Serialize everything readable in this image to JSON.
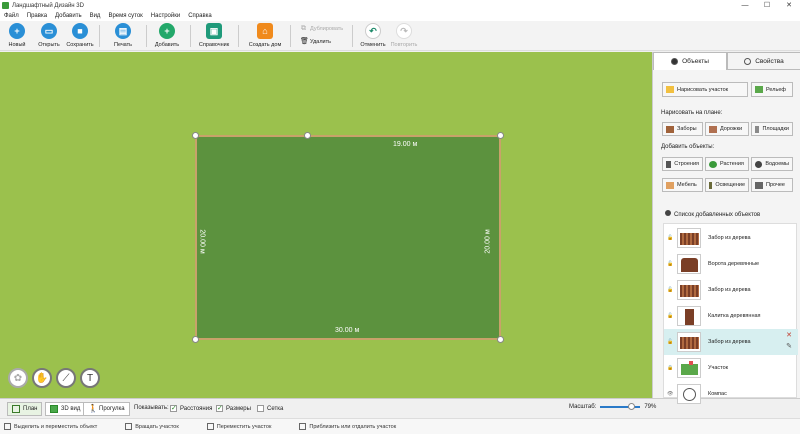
{
  "window": {
    "title": "Ландшафтный Дизайн 3D",
    "controls": [
      "—",
      "☐",
      "✕"
    ]
  },
  "menu": [
    "Файл",
    "Правка",
    "Добавить",
    "Вид",
    "Время суток",
    "Настройки",
    "Справка"
  ],
  "toolbar": {
    "new_label": "Новый",
    "open_label": "Открыть",
    "save_label": "Сохранить",
    "print_label": "Печать",
    "add_label": "Добавить",
    "reference_label": "Справочник",
    "create_house_label": "Создать дом",
    "duplicate_label": "Дублировать",
    "delete_label": "Удалить",
    "undo_label": "Отменить",
    "redo_label": "Повторить"
  },
  "canvas": {
    "dim_top": "19.00 м",
    "dim_bottom": "30.00 м",
    "dim_left": "20.00 м",
    "dim_right": "20.00 м"
  },
  "view_modes": {
    "plan": "План",
    "view3d": "3D вид",
    "walk": "Прогулка"
  },
  "show": {
    "label": "Показывать:",
    "distances": "Расстояния",
    "sizes": "Размеры",
    "grid": "Сетка",
    "distances_checked": true,
    "sizes_checked": true,
    "grid_checked": false
  },
  "scale": {
    "label": "Масштаб:",
    "value": "79%",
    "level_percent": 79
  },
  "status": {
    "select_move": "Выделить и переместить объект",
    "rotate": "Вращать участок",
    "move": "Переместить участок",
    "zoom": "Приблизить или отдалить участок"
  },
  "panel": {
    "tab_objects": "Объекты",
    "tab_properties": "Свойства",
    "draw_plot": "Нарисовать участок",
    "relief": "Рельеф",
    "draw_on_plan": "Нарисовать на плане:",
    "fences": "Заборы",
    "paths": "Дорожки",
    "platforms": "Площадки",
    "add_objects": "Добавить объекты:",
    "buildings": "Строения",
    "plants": "Растения",
    "ponds": "Водоемы",
    "furniture": "Мебель",
    "lighting": "Освещение",
    "other": "Прочее",
    "list_title": "Список добавленных объектов",
    "items": [
      {
        "label": "Забор из дерева"
      },
      {
        "label": "Ворота деревянные"
      },
      {
        "label": "Забор из дерева"
      },
      {
        "label": "Калитка деревянная"
      },
      {
        "label": "Забор из дерева"
      },
      {
        "label": "Участок"
      },
      {
        "label": "Компас"
      }
    ]
  },
  "colors": {
    "grass": "#9bc14d",
    "plot": "#5c923e",
    "accent": "#2a7ac8",
    "selected": "#d7eff0"
  }
}
